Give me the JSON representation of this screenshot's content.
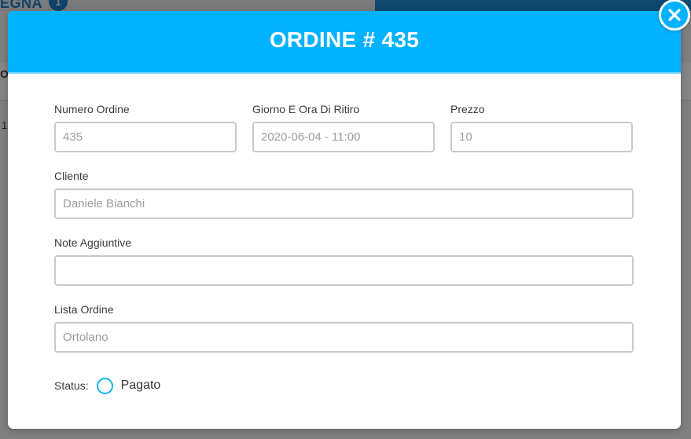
{
  "background": {
    "tab_title": "EGNA",
    "tab_badge": "1",
    "row_label": "Or",
    "cell_label": "1"
  },
  "modal": {
    "title": "ORDINE # 435",
    "close_icon": "close-icon",
    "fields": {
      "numero_ordine": {
        "label": "Numero Ordine",
        "value": "435"
      },
      "giorno_ora": {
        "label": "Giorno E Ora Di Ritiro",
        "value": "2020-06-04 - 11:00"
      },
      "prezzo": {
        "label": "Prezzo",
        "value": "10"
      },
      "cliente": {
        "label": "Cliente",
        "value": "Daniele Bianchi"
      },
      "note": {
        "label": "Note Aggiuntive",
        "value": ""
      },
      "lista_ordine": {
        "label": "Lista Ordine",
        "value": "Ortolano"
      }
    },
    "status": {
      "label": "Status:",
      "option_label": "Pagato",
      "checked": false
    }
  },
  "colors": {
    "accent": "#00b2ff",
    "radio_border": "#13b3f0",
    "background_dim": "#808080",
    "topbar_dark": "#0e4a6e"
  }
}
